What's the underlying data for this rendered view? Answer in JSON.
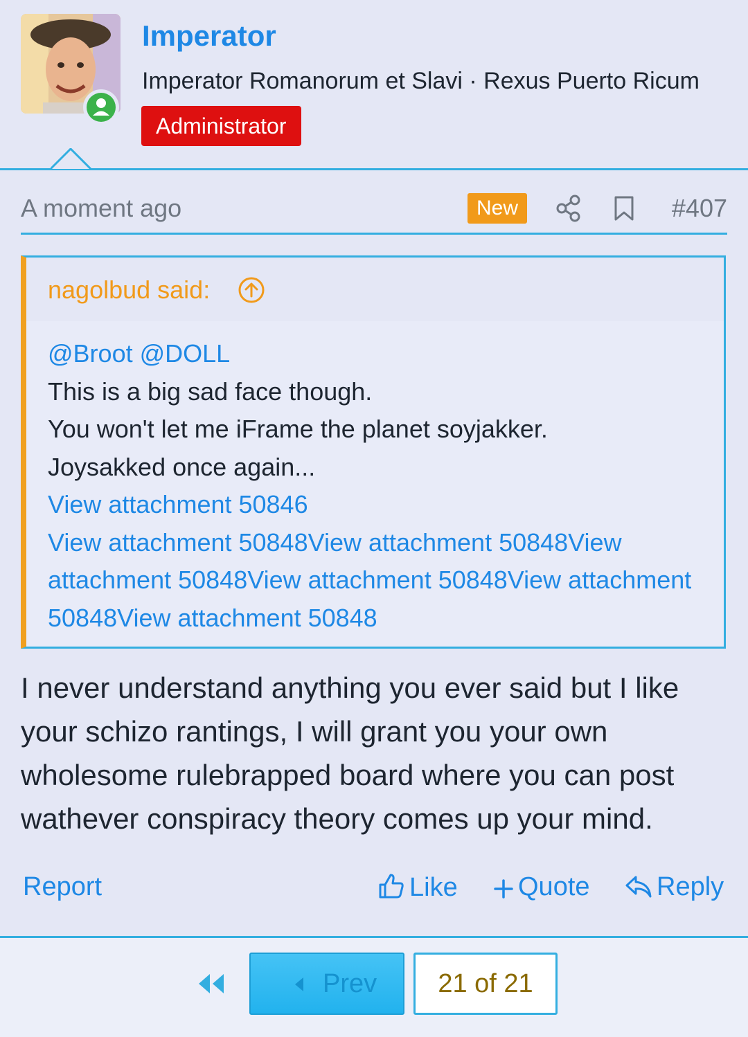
{
  "user": {
    "name": "Imperator",
    "title": "Imperator Romanorum et Slavi · Rexus Puerto Ricum",
    "role": "Administrator"
  },
  "post": {
    "time": "A moment ago",
    "new_badge": "New",
    "number": "#407",
    "quote": {
      "author": "nagolbud said:",
      "mentions": "@Broot @DOLL",
      "lines": [
        "This is a big sad face though.",
        "You won't let me iFrame the planet soyjakker.",
        "Joysakked once again..."
      ],
      "attachment_link": "View attachment 50846",
      "attachment_links_repeated": "View attachment 50848View attachment 50848View attachment 50848View attachment 50848View attachment 50848View attachment 50848"
    },
    "message": "I never understand anything you ever said but I like your schizo rantings, I will grant you your own wholesome rulebrapped board where you can post wathever conspiracy theory comes up your mind."
  },
  "actions": {
    "report": "Report",
    "like": "Like",
    "quote": "Quote",
    "reply": "Reply"
  },
  "pagination": {
    "prev": "Prev",
    "page": "21 of 21"
  },
  "colors": {
    "accent": "#1e88e5",
    "border": "#33aee0",
    "admin_badge": "#de1010",
    "new_badge": "#f19a1a",
    "online": "#3bb24a",
    "quote_bar": "#f0a020"
  }
}
